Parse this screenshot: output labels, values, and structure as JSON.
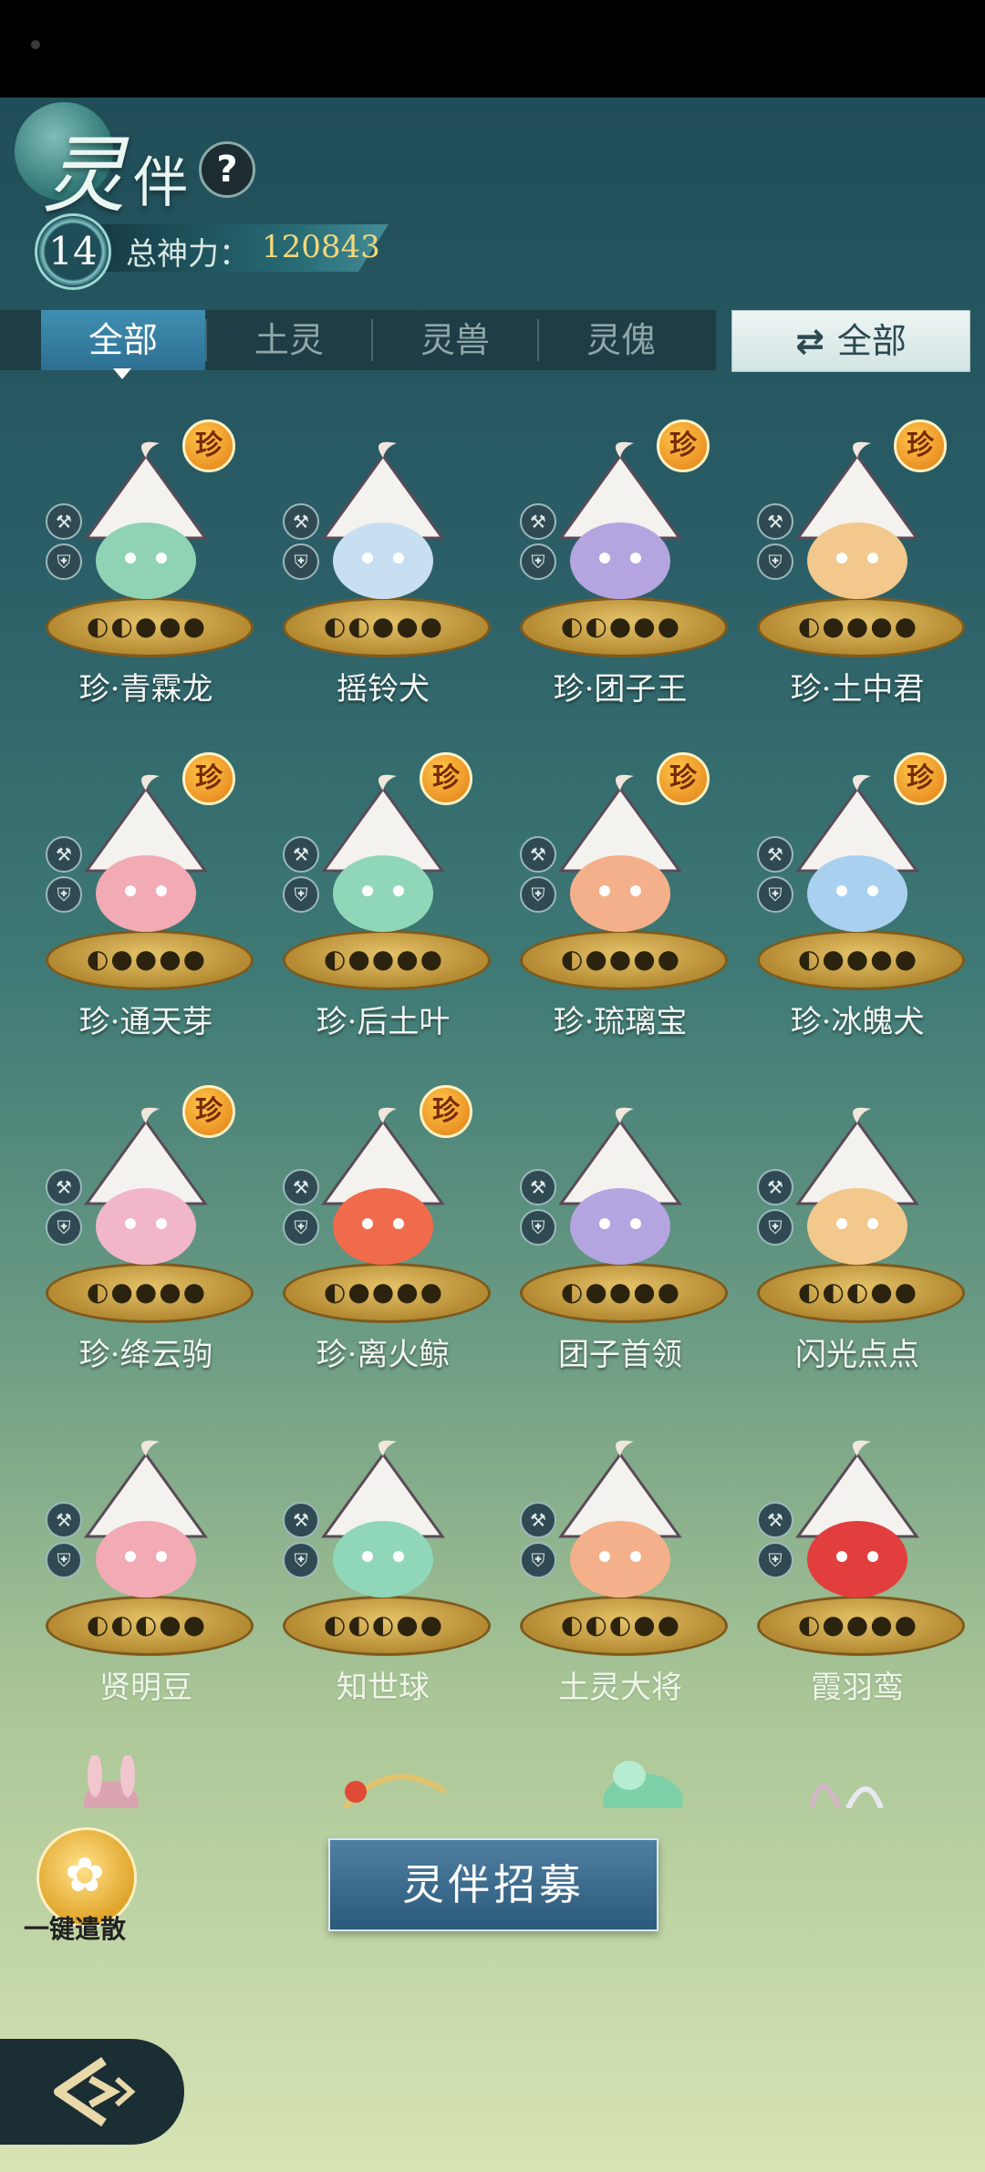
{
  "header": {
    "title_main": "灵",
    "title_sub": "伴",
    "help_symbol": "?",
    "level": "14",
    "power_label": "总神力：",
    "power_value": "120843"
  },
  "tabs": [
    {
      "label": "全部",
      "active": true
    },
    {
      "label": "土灵",
      "active": false
    },
    {
      "label": "灵兽",
      "active": false
    },
    {
      "label": "灵傀",
      "active": false
    }
  ],
  "filter": {
    "icon": "⇄",
    "label": "全部"
  },
  "rare_mark": "珍",
  "cards": [
    {
      "name": "珍·青霖龙",
      "rare": true,
      "stars_on": 2,
      "color": "#8fd3b4"
    },
    {
      "name": "摇铃犬",
      "rare": false,
      "stars_on": 2,
      "color": "#c8dff2"
    },
    {
      "name": "珍·团子王",
      "rare": true,
      "stars_on": 2,
      "color": "#b4a4e0"
    },
    {
      "name": "珍·土中君",
      "rare": true,
      "stars_on": 1,
      "color": "#f2c88c"
    },
    {
      "name": "珍·通天芽",
      "rare": true,
      "stars_on": 1,
      "color": "#f2aab4"
    },
    {
      "name": "珍·后土叶",
      "rare": true,
      "stars_on": 1,
      "color": "#8fd7b8"
    },
    {
      "name": "珍·琉璃宝",
      "rare": true,
      "stars_on": 1,
      "color": "#f4b08a"
    },
    {
      "name": "珍·冰魄犬",
      "rare": true,
      "stars_on": 1,
      "color": "#a9d0ee"
    },
    {
      "name": "珍·绛云驹",
      "rare": true,
      "stars_on": 1,
      "color": "#f1b6c8"
    },
    {
      "name": "珍·离火鲸",
      "rare": true,
      "stars_on": 1,
      "color": "#f06b4c"
    },
    {
      "name": "团子首领",
      "rare": false,
      "stars_on": 1,
      "color": "#b4a4e0"
    },
    {
      "name": "闪光点点",
      "rare": false,
      "stars_on": 3,
      "color": "#f2c88c"
    },
    {
      "name": "贤明豆",
      "rare": false,
      "stars_on": 3,
      "color": "#f2aab4"
    },
    {
      "name": "知世球",
      "rare": false,
      "stars_on": 3,
      "color": "#8fd7b8"
    },
    {
      "name": "土灵大将",
      "rare": false,
      "stars_on": 3,
      "color": "#f4b08a"
    },
    {
      "name": "霞羽鸾",
      "rare": false,
      "stars_on": 1,
      "color": "#e23e3e"
    }
  ],
  "bottom": {
    "dismiss_label": "一键遣散",
    "recruit_label": "灵伴招募"
  }
}
